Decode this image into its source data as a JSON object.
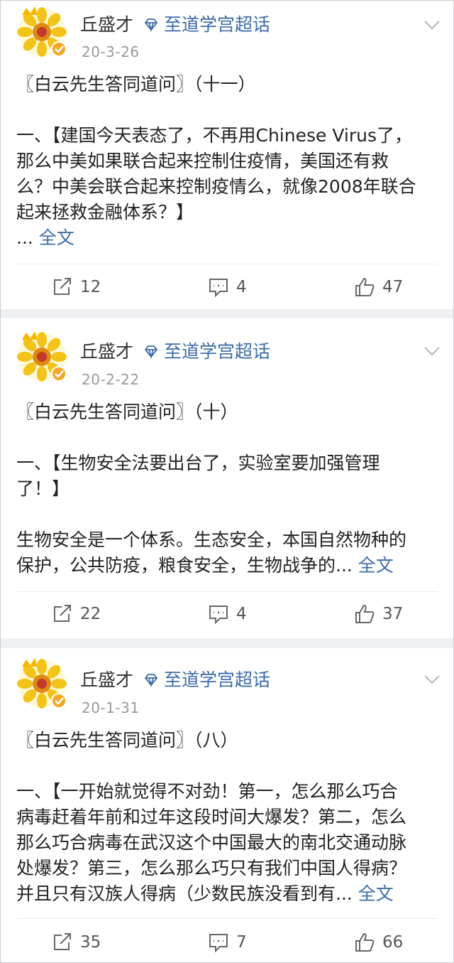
{
  "posts": [
    {
      "author": "丘盛才",
      "topic": "至道学宫超话",
      "date": "20-3-26",
      "title": "〖白云先生答同道问〗（十一）",
      "lines": [
        "一、【建国今天表态了，不再用Chinese Virus了，",
        "那么中美如果联合起来控制住疫情，美国还有救",
        "么？中美会联合起来控制疫情么，就像2008年联合",
        "起来拯救金融体系？】"
      ],
      "ellipsis": "...",
      "more_label": "全文",
      "shares": "12",
      "comments": "4",
      "likes": "47"
    },
    {
      "author": "丘盛才",
      "topic": "至道学宫超话",
      "date": "20-2-22",
      "title": "〖白云先生答同道问〗（十）",
      "lines": [
        "一、【生物安全法要出台了，实验室要加强管理",
        "了！】",
        "",
        "生物安全是一个体系。生态安全，本国自然物种的",
        "保护，公共防疫，粮食安全，生物战争的..."
      ],
      "more_label": "全文",
      "shares": "22",
      "comments": "4",
      "likes": "37"
    },
    {
      "author": "丘盛才",
      "topic": "至道学宫超话",
      "date": "20-1-31",
      "title": "〖白云先生答同道问〗（八）",
      "lines": [
        "一、【一开始就觉得不对劲！第一，怎么那么巧合",
        "病毒赶着年前和过年这段时间大爆发？第二，怎么",
        "那么巧合病毒在武汉这个中国最大的南北交通动脉",
        "处爆发？第三，怎么那么巧只有我们中国人得病？",
        "并且只有汉族人得病（少数民族没看到有..."
      ],
      "more_label": "全文",
      "shares": "35",
      "comments": "7",
      "likes": "66"
    }
  ],
  "colors": {
    "link": "#3c6ca8",
    "background": "#eef0f3",
    "verified": "#f5a623"
  },
  "icons": {
    "avatar": "sunflower-avatar-icon",
    "verified": "verified-badge-icon",
    "topic": "diamond-icon",
    "menu": "chevron-down-icon",
    "share": "share-icon",
    "comment": "comment-icon",
    "like": "thumbs-up-icon"
  }
}
